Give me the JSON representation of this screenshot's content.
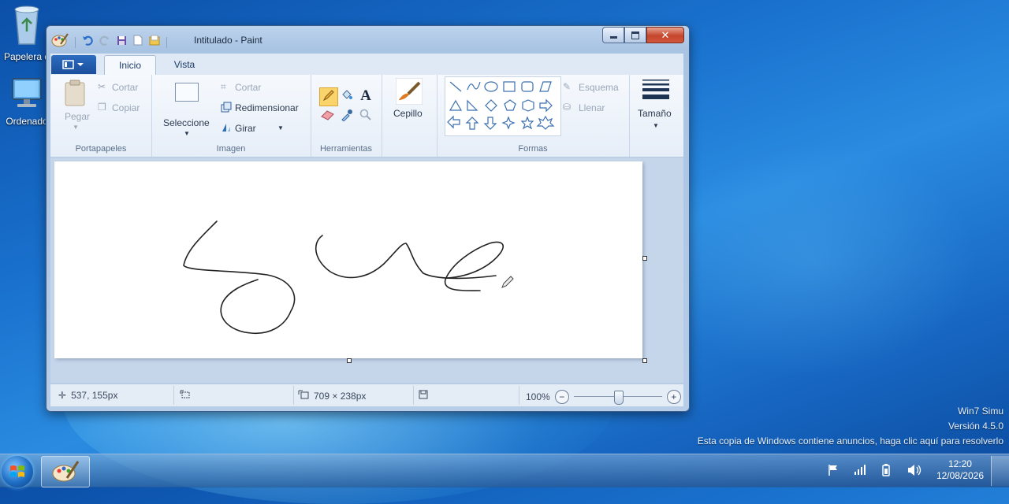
{
  "desktop": {
    "icons": [
      {
        "label": "Papelera d",
        "icon": "recycle-bin-icon"
      },
      {
        "label": "Ordenado",
        "icon": "computer-icon"
      }
    ],
    "watermark": {
      "line1": "Win7 Simu",
      "line2": "Versión 4.5.0",
      "line3": "Esta copia de Windows contiene anuncios, haga clic aquí para resolverlo"
    }
  },
  "window": {
    "title": "Intitulado - Paint",
    "tabs": [
      "Inicio",
      "Vista"
    ],
    "active_tab": "Inicio"
  },
  "ribbon": {
    "portapapeles": {
      "paste": "Pegar",
      "cut": "Cortar",
      "copy": "Copiar",
      "label": "Portapapeles"
    },
    "imagen": {
      "select": "Seleccione",
      "crop": "Cortar",
      "resize": "Redimensionar",
      "rotate": "Girar",
      "label": "Imagen"
    },
    "herramientas": {
      "label": "Herramientas",
      "active_tool": "pencil"
    },
    "brush": {
      "label": "Cepillo"
    },
    "formas": {
      "outline": "Esquema",
      "fill": "Llenar",
      "label": "Formas"
    },
    "size": {
      "label": "Tamaño"
    }
  },
  "status": {
    "cursor_pos": "537, 155px",
    "canvas_size": "709 × 238px",
    "zoom": "100%",
    "zoom_level": 1.0
  },
  "taskbar": {
    "time": "12:20",
    "date": "12/08/2026"
  },
  "colors": {
    "accent": "#1a4f9c",
    "close_button": "#c4452c",
    "desktop_blue": "#1a73cf"
  }
}
